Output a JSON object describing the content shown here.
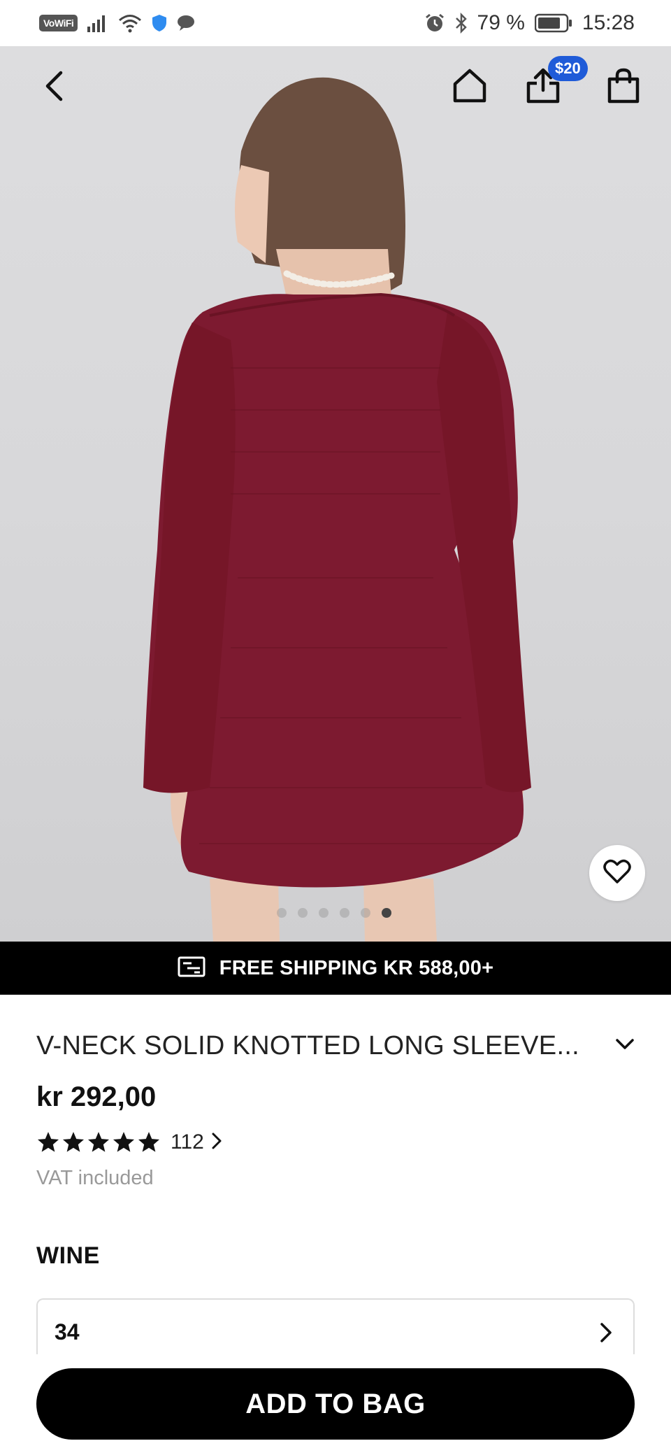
{
  "status_bar": {
    "vowifi": "VoWiFi",
    "battery": "79 %",
    "time": "15:28"
  },
  "nav": {
    "back_icon": "chevron-left-icon",
    "home_icon": "home-icon",
    "share_icon": "share-icon",
    "share_badge": "$20",
    "bag_icon": "shopping-bag-icon"
  },
  "gallery": {
    "image_count": 6,
    "active_index": 5,
    "wishlist_icon": "heart-icon"
  },
  "shipping": {
    "icon": "shipping-icon",
    "text": "FREE SHIPPING KR 588,00+"
  },
  "product": {
    "title": "V-NECK SOLID KNOTTED LONG SLEEVE...",
    "price": "kr 292,00",
    "rating_stars": 5,
    "review_count": "112",
    "vat_note": "VAT included",
    "color": "WINE",
    "size": "34"
  },
  "actions": {
    "add_to_bag": "ADD TO BAG"
  },
  "colors": {
    "dress": "#7d1a30",
    "badge": "#1f5bd8"
  }
}
